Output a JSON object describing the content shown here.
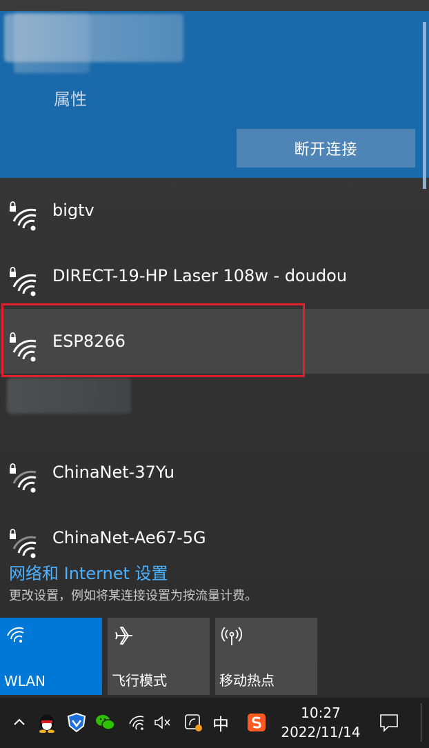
{
  "connected": {
    "properties_label": "属性",
    "disconnect_label": "断开连接"
  },
  "networks": [
    {
      "name": "bigtv",
      "secured": true
    },
    {
      "name": "DIRECT-19-HP Laser 108w - doudou",
      "secured": true
    },
    {
      "name": "ESP8266",
      "secured": true
    },
    {
      "name": "ChinaNet-37Yu",
      "secured": true
    },
    {
      "name": "ChinaNet-Ae67-5G",
      "secured": true
    }
  ],
  "settings": {
    "link": "网络和 Internet 设置",
    "description": "更改设置，例如将某连接设置为按流量计费。"
  },
  "tiles": [
    {
      "label": "WLAN",
      "icon": "wifi-icon",
      "active": true
    },
    {
      "label": "飞行模式",
      "icon": "airplane-icon",
      "active": false
    },
    {
      "label": "移动热点",
      "icon": "hotspot-icon",
      "active": false
    }
  ],
  "taskbar": {
    "input_method": "中",
    "time": "10:27",
    "date": "2022/11/14"
  },
  "colors": {
    "accent": "#0078d7",
    "connected_bg": "#1a6aab",
    "highlight_border": "#e0202a",
    "link": "#4cb1ff"
  }
}
